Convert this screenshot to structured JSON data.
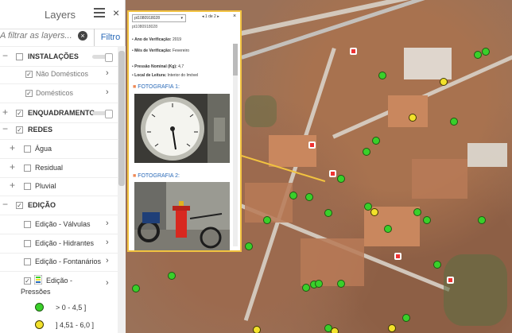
{
  "panel": {
    "title": "Layers",
    "filter_placeholder": "A filtrar as layers...",
    "filter_button": "Filtro",
    "rows": [
      {
        "label": "INSTALAÇÕES"
      },
      {
        "label": "Não Domésticos"
      },
      {
        "label": "Domésticos"
      },
      {
        "label": "ENQUADRAMENTO"
      },
      {
        "label": "REDES"
      },
      {
        "label": "Água"
      },
      {
        "label": "Residual"
      },
      {
        "label": "Pluvial"
      },
      {
        "label": "EDIÇÃO"
      },
      {
        "label": "Edição - Válvulas"
      },
      {
        "label": "Edição - Hidrantes"
      },
      {
        "label": "Edição - Fontanários"
      },
      {
        "label": "Edição -"
      },
      {
        "label": "Pressões"
      }
    ],
    "legend": [
      {
        "label": "> 0 - 4,5 ]",
        "color": "#39d02a"
      },
      {
        "label": "] 4,51 - 6,0 ]",
        "color": "#f2e12b"
      }
    ]
  },
  "popup": {
    "selector": "pt1080918028",
    "pager": "1 de 2",
    "id": "pt1080918028",
    "fields": [
      {
        "label": "Ano de Verificação:",
        "value": "2019"
      },
      {
        "label": "Mês de Verificação:",
        "value": "Fevereiro"
      },
      {
        "label": "Pressão Nominal (Kg):",
        "value": "4,7"
      },
      {
        "label": "Local de Leitura:",
        "value": "Interior do Imóvel"
      }
    ],
    "photo1_label": "FOTOGRAFIA 1:",
    "photo2_label": "FOTOGRAFIA 2:"
  },
  "colors": {
    "accent": "#2a6ab8",
    "popup_border": "#f2c340",
    "marker_green": "#39d02a",
    "marker_yellow": "#f2e12b"
  }
}
